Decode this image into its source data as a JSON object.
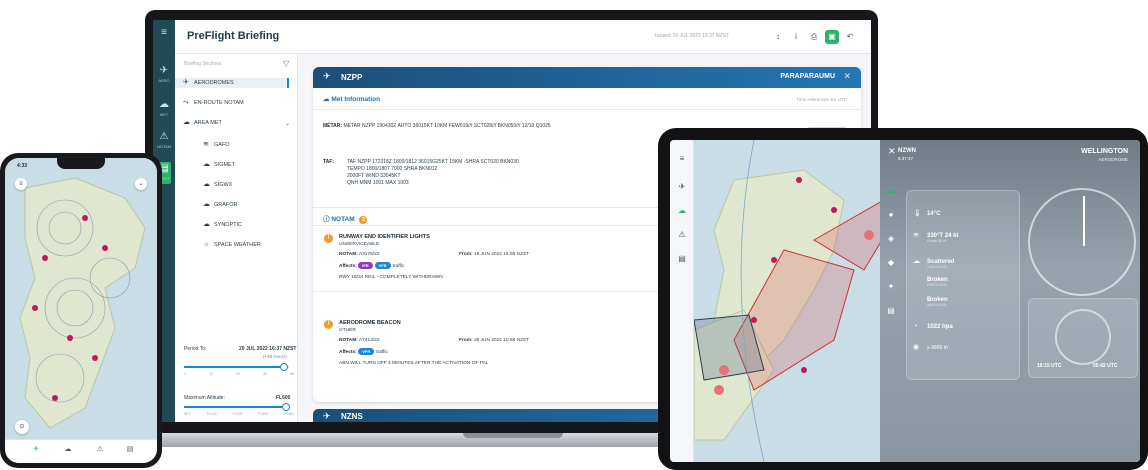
{
  "laptop": {
    "app_title": "PreFlight Briefing",
    "issued": "Issued: 19 JUL 2022 16:37 NZST",
    "rail": [
      {
        "icon": "aero-icon",
        "label": "AERO"
      },
      {
        "icon": "met-icon",
        "label": "MET"
      },
      {
        "icon": "notam-icon",
        "label": "NOTAM"
      },
      {
        "icon": "briefing-icon",
        "label": "BRIEF"
      }
    ],
    "sidebar": {
      "heading": "Briefing Sections",
      "items": [
        {
          "icon": "plane-icon",
          "label": "AERODROMES"
        },
        {
          "icon": "route-icon",
          "label": "EN-ROUTE NOTAM"
        },
        {
          "icon": "cloud-icon",
          "label": "AREA MET"
        }
      ],
      "subitems": [
        {
          "icon": "wind-icon",
          "label": "GAFO"
        },
        {
          "icon": "cloud-icon",
          "label": "SIGMET"
        },
        {
          "icon": "cloud-icon",
          "label": "SIGWX"
        },
        {
          "icon": "cloud-icon",
          "label": "GRAFOR"
        },
        {
          "icon": "cloud-icon",
          "label": "SYNOPTIC"
        },
        {
          "icon": "sun-icon",
          "label": "SPACE WEATHER"
        }
      ],
      "period_label": "Period To:",
      "period_value": "20 JUL 2022 16:37 NZST",
      "period_sub": "(+48 Hours)",
      "period_fill": 0.95,
      "period_ticks": [
        "1",
        "12",
        "24",
        "36",
        "48"
      ],
      "alt_label": "Maximum Altitude:",
      "alt_value": "FL600",
      "alt_fill": 0.97,
      "alt_ticks": [
        "SFC",
        "FL100",
        "FL200",
        "FL300",
        "FL400"
      ]
    },
    "aerodrome": {
      "code": "NZPP",
      "name": "PARAPARAUMU",
      "met_title": "Met Information",
      "met_right": "Time references are UTC",
      "metar_label": "METAR:",
      "metar_text": "METAR NZPP 190430Z AUTO 36015KT 10KM FEW019/// SCT028/// BKN050/// 12/10 Q1025",
      "latest": "Latest",
      "taf_label": "TAF:",
      "taf_lines": [
        "TAF NZPP 172318Z 1800/1812 36015G25KT 15KM -SHRA SCT020 BKN030",
        "TEMPO 1800/1807 7000 SHRA BKN012",
        "2000FT WIND 33045KT",
        "QNH MNM 1001 MAX 1003"
      ],
      "notam_title": "NOTAM",
      "notam_count": "2",
      "notams": [
        {
          "title": "RUNWAY END IDENTIFIER LIGHTS",
          "sub": "UNSERVICEABLE",
          "notam_label": "NOTAM:",
          "notam_id": "A3176/22",
          "from_label": "From:",
          "from_value": "19 JUN 2022 16:56 NZST",
          "affects_label": "Affects:",
          "pills": [
            "IFR",
            "VFR"
          ],
          "affects_text": "traffic",
          "body": "RWY 16/34 REIL - COMPLETELY WITHDRAWN"
        },
        {
          "title": "AERODROME BEACON",
          "sub": "OTHER",
          "notam_label": "NOTAM:",
          "notam_id": "A7413/22",
          "from_label": "From:",
          "from_value": "28 JUN 2022 10:68 NZST",
          "affects_label": "Affects:",
          "pills": [
            "VFR"
          ],
          "affects_text": "traffic",
          "body": "ABN WILL TURN OFF 4 MINUTES AFTER THE ACTIVATION OF PAL"
        }
      ]
    },
    "next_aerodrome": {
      "code": "NZNS"
    }
  },
  "phone": {
    "time": "4:33",
    "tabs": [
      {
        "icon": "aero-icon",
        "label": "AERO"
      },
      {
        "icon": "met-icon",
        "label": ""
      },
      {
        "icon": "notam-icon",
        "label": ""
      },
      {
        "icon": "briefing-icon",
        "label": ""
      }
    ]
  },
  "tablet": {
    "aerodrome_code": "NZWN",
    "aerodrome_time": "6:37:47",
    "aerodrome_name": "WELLINGTON",
    "aerodrome_kind": "AERODROME",
    "met": [
      {
        "icon": "thermometer-icon",
        "value": "14°C",
        "sub": ""
      },
      {
        "icon": "wind-icon",
        "value": "330°T 24 kt",
        "sub": "Gusts 35 kt"
      },
      {
        "icon": "cloud-icon",
        "value": "Scattered",
        "sub": "1400 ft AGL"
      },
      {
        "icon": "cloud-icon",
        "value": "Broken",
        "sub": "2400 ft AGL"
      },
      {
        "icon": "cloud-icon",
        "value": "Broken",
        "sub": "4400 ft AGL"
      },
      {
        "icon": "pressure-icon",
        "value": "1022 hpa",
        "sub": ""
      },
      {
        "icon": "visibility-icon",
        "value": "≥ 9999 m",
        "sub": ""
      }
    ],
    "sunrise": "19:15 UTC",
    "sunset": "05:42 UTC"
  }
}
